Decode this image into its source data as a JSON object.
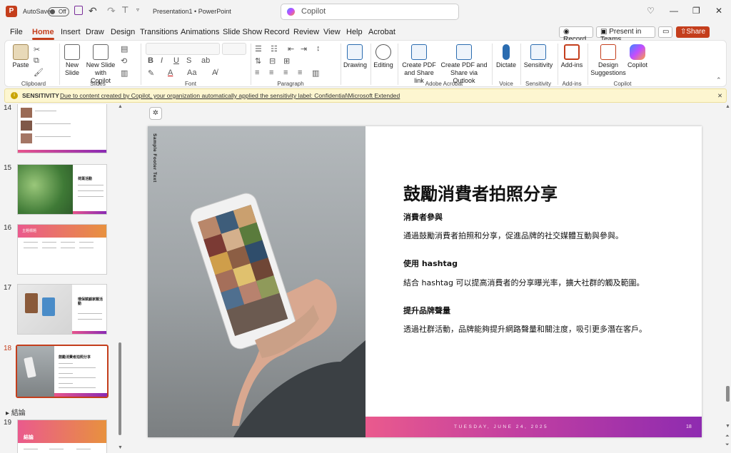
{
  "app": {
    "logo": "P",
    "autosave_label": "AutoSave",
    "autosave_state": "Off",
    "title": "Presentation1 • PowerPoint",
    "search_placeholder": "Copilot"
  },
  "tabs": [
    "File",
    "Home",
    "Insert",
    "Draw",
    "Design",
    "Transitions",
    "Animations",
    "Slide Show",
    "Record",
    "Review",
    "View",
    "Help",
    "Acrobat"
  ],
  "topbuttons": {
    "record": "Record",
    "present_teams": "Present in Teams",
    "share": "Share"
  },
  "ribbon": {
    "paste": "Paste",
    "clipboard": "Clipboard",
    "new_slide": "New Slide",
    "new_slide_copilot": "New Slide with Copilot",
    "slides": "Slides",
    "font": "Font",
    "paragraph": "Paragraph",
    "drawing": "Drawing",
    "editing": "Editing",
    "create_pdf_share": "Create PDF and Share link",
    "create_pdf_outlook": "Create PDF and Share via Outlook",
    "adobe_acrobat": "Adobe Acrobat",
    "dictate": "Dictate",
    "voice": "Voice",
    "sensitivity_btn": "Sensitivity",
    "sensitivity_grp": "Sensitivity",
    "addins_btn": "Add-ins",
    "addins_grp": "Add-ins",
    "design_suggestions": "Design Suggestions",
    "copilot_btn": "Copilot",
    "copilot_grp": "Copilot",
    "bold": "B",
    "italic": "I",
    "underline": "U",
    "strike": "S",
    "font_size_a": "Aa"
  },
  "sensitivity_bar": {
    "title": "SENSITIVITY",
    "text": "Due to content created by Copilot, your organization automatically applied the sensitivity label: Confidential\\Microsoft Extended"
  },
  "thumbnails": {
    "numbers": [
      "14",
      "15",
      "16",
      "17",
      "18",
      "19"
    ],
    "section_label": "結論",
    "t15_title": "荷葉活動",
    "t16_title": "主題標題",
    "t17_title": "環保賦顧家醒活動",
    "t18_title": "鼓勵消費者拍照分享",
    "t19_title": "結論"
  },
  "slide": {
    "footer_vertical": "Sample Footer Text",
    "title": "鼓勵消費者拍照分享",
    "sections": [
      {
        "heading": "消費者參與",
        "body": "通過鼓勵消費者拍照和分享，促進品牌的社交媒體互動與參與。"
      },
      {
        "heading": "使用 hashtag",
        "body": "結合 hashtag 可以提高消費者的分享曝光率，擴大社群的觸及範圍。"
      },
      {
        "heading": "提升品牌聲量",
        "body": "透過社群活動，品牌能夠提升網路聲量和關注度，吸引更多潛在客戶。"
      }
    ],
    "footer_date": "TUESDAY, JUNE 24, 2025",
    "slide_number": "18"
  },
  "colors": {
    "accent": "#c43e1c",
    "gradient_start": "#ea5a8d",
    "gradient_end": "#8e2bb0"
  }
}
